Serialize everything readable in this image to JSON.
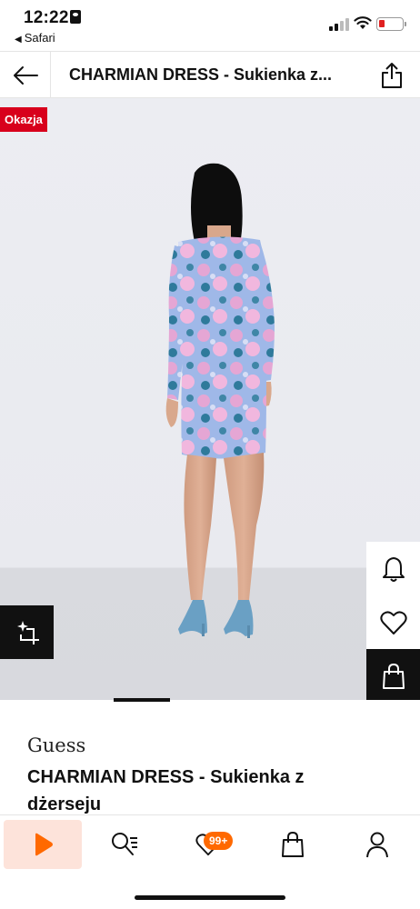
{
  "status_bar": {
    "time": "12:22",
    "back_app": "Safari"
  },
  "header": {
    "title": "CHARMIAN DRESS - Sukienka z..."
  },
  "product_image": {
    "sale_badge": "Okazja",
    "carousel": {
      "total": 3,
      "current": 2
    }
  },
  "product": {
    "brand": "Guess",
    "name": "CHARMIAN DRESS - Sukienka z dżerseju"
  },
  "bottom_nav": {
    "items": [
      {
        "id": "home",
        "icon": "play-icon"
      },
      {
        "id": "search",
        "icon": "search-list-icon"
      },
      {
        "id": "wishlist",
        "icon": "heart-icon",
        "badge": "99+"
      },
      {
        "id": "bag",
        "icon": "bag-icon"
      },
      {
        "id": "profile",
        "icon": "user-icon"
      }
    ]
  },
  "colors": {
    "accent": "#ff6900",
    "sale": "#d8001c",
    "active_tab_bg": "#fde3da"
  }
}
